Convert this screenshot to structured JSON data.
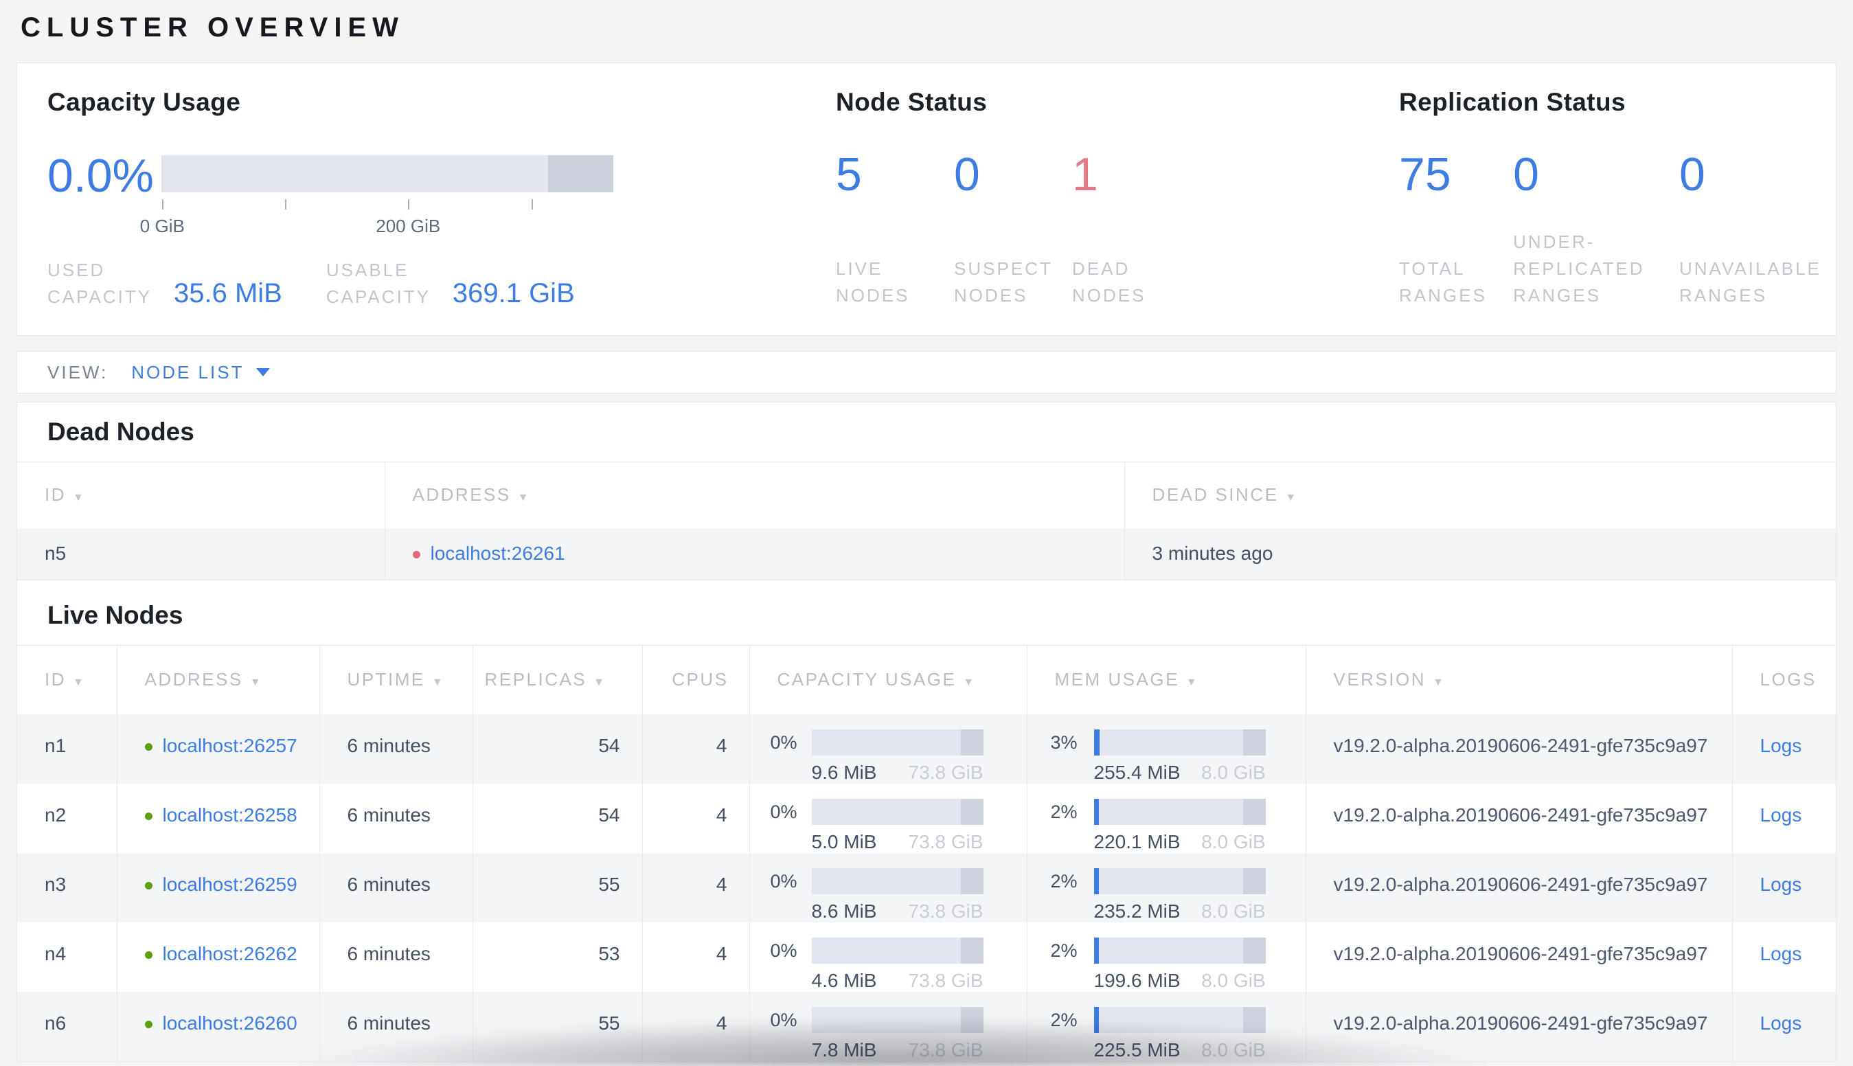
{
  "page": {
    "title": "CLUSTER OVERVIEW"
  },
  "colors": {
    "accent_blue": "#3d7ce0",
    "danger_rose": "#e07a87",
    "live_dot_green": "#5ba10e",
    "dead_dot_red": "#e0697a",
    "bar_track": "#e3e6ee",
    "bar_reserved": "#cdd2dc"
  },
  "summary": {
    "capacity": {
      "title": "Capacity Usage",
      "percent": "0.0%",
      "tick_labels": [
        "0 GiB",
        "200 GiB"
      ],
      "used_label": "USED CAPACITY",
      "used_value": "35.6 MiB",
      "usable_label": "USABLE CAPACITY",
      "usable_value": "369.1 GiB"
    },
    "node_status": {
      "title": "Node Status",
      "stats": [
        {
          "value": "5",
          "label": "LIVE NODES"
        },
        {
          "value": "0",
          "label": "SUSPECT NODES"
        },
        {
          "value": "1",
          "label": "DEAD NODES"
        }
      ]
    },
    "replication": {
      "title": "Replication Status",
      "stats": [
        {
          "value": "75",
          "label": "TOTAL RANGES"
        },
        {
          "value": "0",
          "label": "UNDER-REPLICATED RANGES"
        },
        {
          "value": "0",
          "label": "UNAVAILABLE RANGES"
        }
      ]
    }
  },
  "view_bar": {
    "label": "VIEW:",
    "selected": "NODE LIST"
  },
  "dead_nodes": {
    "heading": "Dead Nodes",
    "columns": [
      "ID",
      "ADDRESS",
      "DEAD SINCE"
    ],
    "rows": [
      {
        "id": "n5",
        "address": "localhost:26261",
        "dead_since": "3 minutes ago"
      }
    ]
  },
  "live_nodes": {
    "heading": "Live Nodes",
    "columns": [
      "ID",
      "ADDRESS",
      "UPTIME",
      "REPLICAS",
      "CPUS",
      "CAPACITY USAGE",
      "MEM USAGE",
      "VERSION",
      "LOGS"
    ],
    "rows": [
      {
        "id": "n1",
        "address": "localhost:26257",
        "uptime": "6 minutes",
        "replicas": "54",
        "cpus": "4",
        "capacity_pct": "0%",
        "capacity_pct_num": 0,
        "capacity_used": "9.6 MiB",
        "capacity_total": "73.8 GiB",
        "mem_pct": "3%",
        "mem_pct_num": 3.5,
        "mem_used": "255.4 MiB",
        "mem_total": "8.0 GiB",
        "version": "v19.2.0-alpha.20190606-2491-gfe735c9a97",
        "logs_label": "Logs"
      },
      {
        "id": "n2",
        "address": "localhost:26258",
        "uptime": "6 minutes",
        "replicas": "54",
        "cpus": "4",
        "capacity_pct": "0%",
        "capacity_pct_num": 0,
        "capacity_used": "5.0 MiB",
        "capacity_total": "73.8 GiB",
        "mem_pct": "2%",
        "mem_pct_num": 3,
        "mem_used": "220.1 MiB",
        "mem_total": "8.0 GiB",
        "version": "v19.2.0-alpha.20190606-2491-gfe735c9a97",
        "logs_label": "Logs"
      },
      {
        "id": "n3",
        "address": "localhost:26259",
        "uptime": "6 minutes",
        "replicas": "55",
        "cpus": "4",
        "capacity_pct": "0%",
        "capacity_pct_num": 0,
        "capacity_used": "8.6 MiB",
        "capacity_total": "73.8 GiB",
        "mem_pct": "2%",
        "mem_pct_num": 3,
        "mem_used": "235.2 MiB",
        "mem_total": "8.0 GiB",
        "version": "v19.2.0-alpha.20190606-2491-gfe735c9a97",
        "logs_label": "Logs"
      },
      {
        "id": "n4",
        "address": "localhost:26262",
        "uptime": "6 minutes",
        "replicas": "53",
        "cpus": "4",
        "capacity_pct": "0%",
        "capacity_pct_num": 0,
        "capacity_used": "4.6 MiB",
        "capacity_total": "73.8 GiB",
        "mem_pct": "2%",
        "mem_pct_num": 3,
        "mem_used": "199.6 MiB",
        "mem_total": "8.0 GiB",
        "version": "v19.2.0-alpha.20190606-2491-gfe735c9a97",
        "logs_label": "Logs"
      },
      {
        "id": "n6",
        "address": "localhost:26260",
        "uptime": "6 minutes",
        "replicas": "55",
        "cpus": "4",
        "capacity_pct": "0%",
        "capacity_pct_num": 0,
        "capacity_used": "7.8 MiB",
        "capacity_total": "73.8 GiB",
        "mem_pct": "2%",
        "mem_pct_num": 3,
        "mem_used": "225.5 MiB",
        "mem_total": "8.0 GiB",
        "version": "v19.2.0-alpha.20190606-2491-gfe735c9a97",
        "logs_label": "Logs"
      }
    ]
  }
}
